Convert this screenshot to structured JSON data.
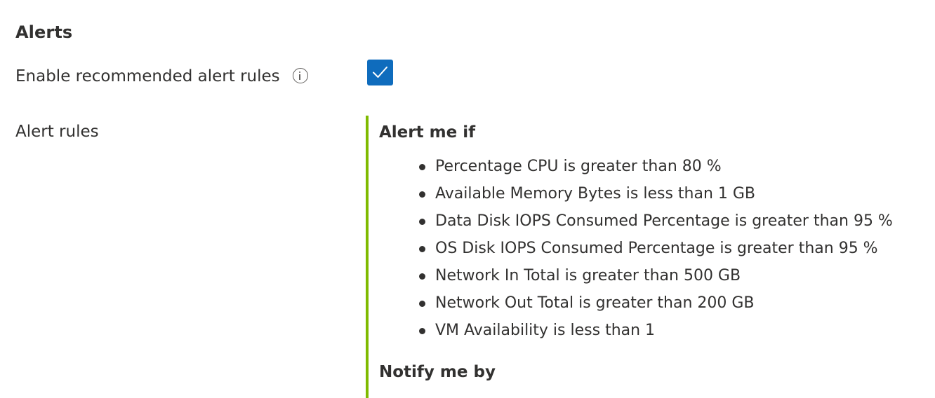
{
  "alerts": {
    "title": "Alerts",
    "enable_label": "Enable recommended alert rules",
    "enable_checked": true,
    "alert_rules_label": "Alert rules",
    "alert_me_if_heading": "Alert me if",
    "rules": [
      "Percentage CPU is greater than 80 %",
      "Available Memory Bytes is less than 1 GB",
      "Data Disk IOPS Consumed Percentage is greater than 95 %",
      "OS Disk IOPS Consumed Percentage is greater than 95 %",
      "Network In Total is greater than 500 GB",
      "Network Out Total is greater than 200 GB",
      "VM Availability is less than 1"
    ],
    "notify_me_by_heading": "Notify me by"
  },
  "colors": {
    "checkbox_fill": "#0f6cbd",
    "panel_border": "#7fba00",
    "text": "#323130"
  },
  "icons": {
    "info": "info-icon",
    "check": "checkmark-icon"
  }
}
